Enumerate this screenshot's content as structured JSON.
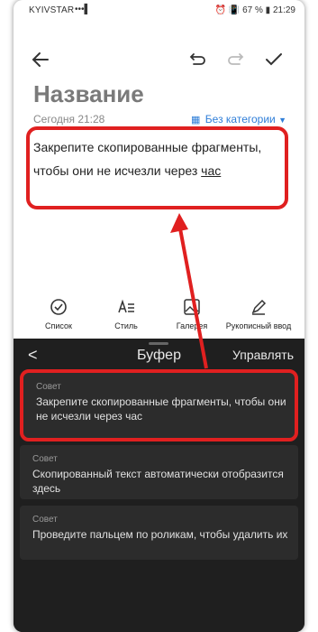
{
  "status": {
    "carrier": "KYIVSTAR",
    "signal": "•••▌",
    "right": "⏰ 📳 67 % ▮ 21:29"
  },
  "toolbar": {
    "back_icon": "back-arrow-icon",
    "undo_icon": "undo-icon",
    "redo_icon": "redo-icon",
    "confirm_icon": "check-icon"
  },
  "note": {
    "title": "Название",
    "date": "Сегодня 21:28",
    "category": "Без категории",
    "text_main": "Закрепите скопированные фрагменты, чтобы они не исчезли через ",
    "text_underlined": "час"
  },
  "tools": [
    {
      "label": "Список",
      "icon": "checklist-icon"
    },
    {
      "label": "Стиль",
      "icon": "text-style-icon"
    },
    {
      "label": "Галерея",
      "icon": "gallery-icon"
    },
    {
      "label": "Рукописный ввод",
      "icon": "pen-icon"
    }
  ],
  "panel": {
    "back": "<",
    "title": "Буфер",
    "manage": "Управлять",
    "items": [
      {
        "label": "Совет",
        "text": "Закрепите скопированные фрагменты, чтобы они не исчезли через час"
      },
      {
        "label": "Совет",
        "text": "Скопированный текст автоматически отобразится здесь"
      },
      {
        "label": "Совет",
        "text": "Проведите пальцем по роликам, чтобы удалить их"
      }
    ]
  },
  "colors": {
    "accent": "#2f7ed8",
    "highlight": "#e02020",
    "panel_bg": "#1f1f1f",
    "card_bg": "#2c2c2c"
  }
}
